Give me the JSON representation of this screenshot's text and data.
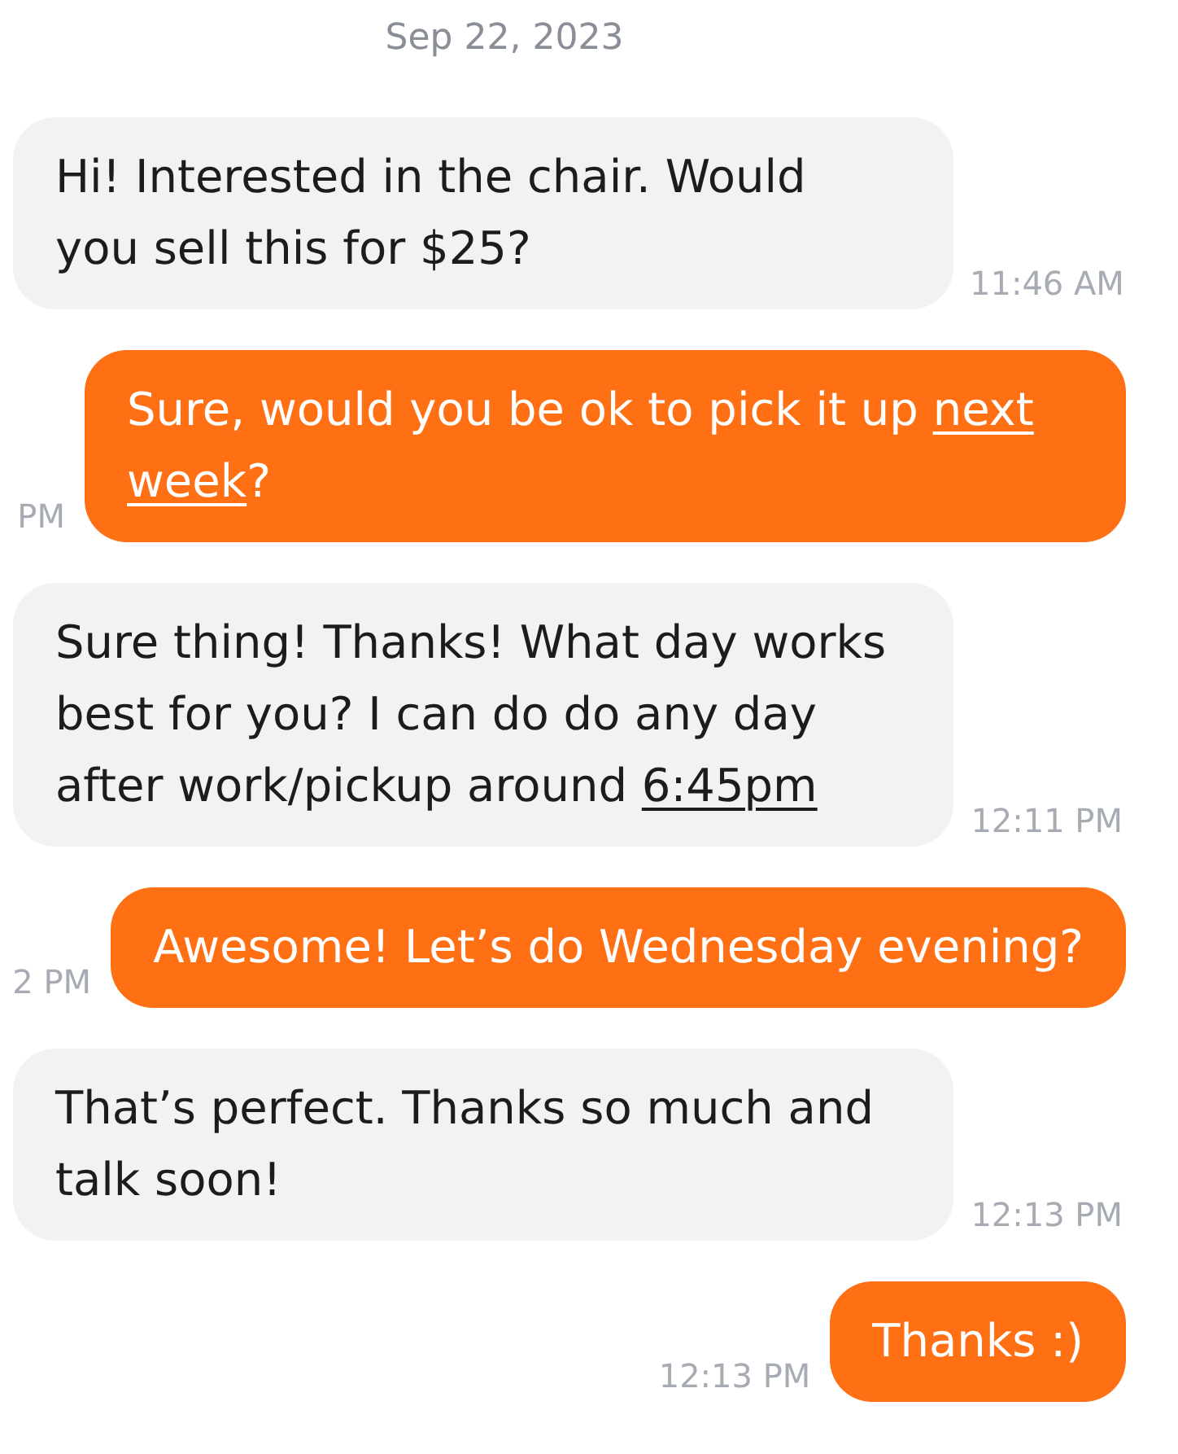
{
  "date": "Sep 22, 2023",
  "messages": [
    {
      "kind": "received",
      "lines": [
        [
          {
            "text": "Hi! Interested in the chair. Would",
            "link": false
          }
        ],
        [
          {
            "text": "you sell this for $25?",
            "link": false
          }
        ]
      ],
      "time": "11:46 AM"
    },
    {
      "kind": "sent",
      "lines": [
        [
          {
            "text": "Sure, would you be ok to pick it up ",
            "link": false
          },
          {
            "text": "next",
            "link": true
          }
        ],
        [
          {
            "text": "week",
            "link": true
          },
          {
            "text": "?",
            "link": false
          }
        ]
      ],
      "time": "PM"
    },
    {
      "kind": "received",
      "lines": [
        [
          {
            "text": "Sure thing! Thanks! What day works",
            "link": false
          }
        ],
        [
          {
            "text": "best for you? I can do do any day",
            "link": false
          }
        ],
        [
          {
            "text": "after work/pickup around ",
            "link": false
          },
          {
            "text": "6:45pm",
            "link": true
          }
        ]
      ],
      "time": "12:11 PM"
    },
    {
      "kind": "sent",
      "lines": [
        [
          {
            "text": "Awesome! Let’s do Wednesday evening?",
            "link": false
          }
        ]
      ],
      "time": "2 PM"
    },
    {
      "kind": "received",
      "lines": [
        [
          {
            "text": "That’s perfect. Thanks so much and",
            "link": false
          }
        ],
        [
          {
            "text": "talk soon!",
            "link": false
          }
        ]
      ],
      "time": "12:13 PM"
    },
    {
      "kind": "sent",
      "lines": [
        [
          {
            "text": "Thanks :)",
            "link": false
          }
        ]
      ],
      "time": "12:13 PM"
    }
  ]
}
